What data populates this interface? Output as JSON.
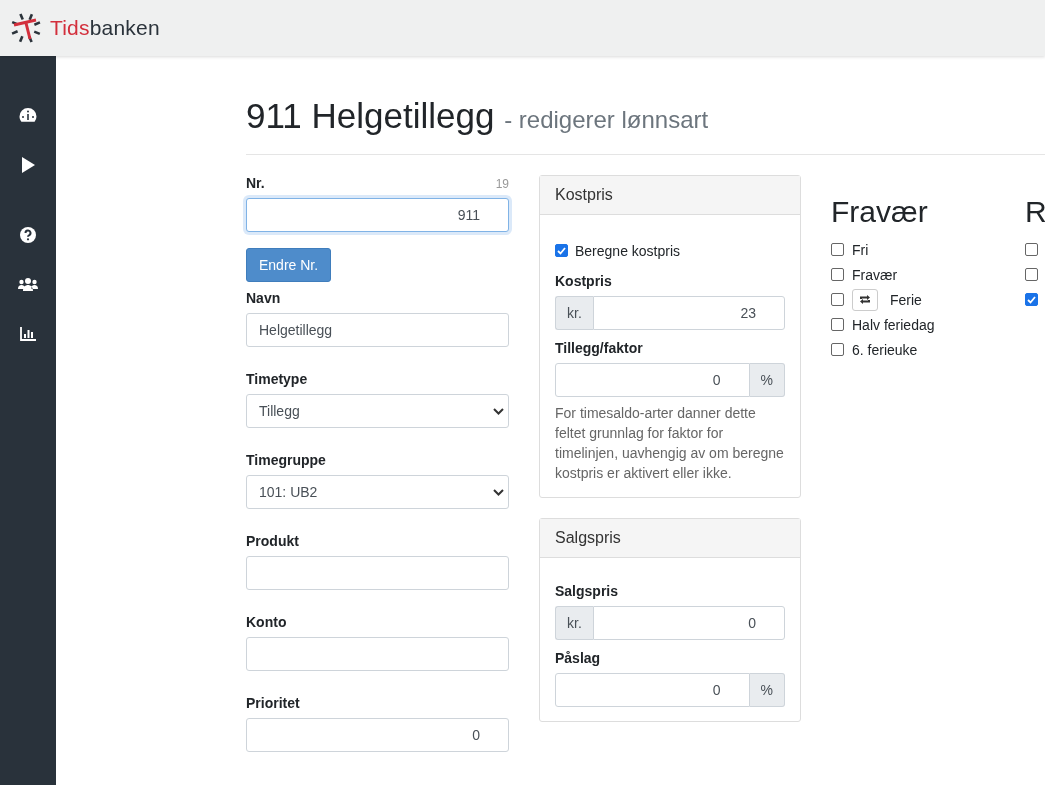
{
  "header": {
    "logo_red": "Tids",
    "logo_dark": "banken"
  },
  "sidebar": {
    "items": [
      {
        "kind": "dashboard"
      },
      {
        "kind": "play"
      },
      {
        "kind": "help"
      },
      {
        "kind": "users"
      },
      {
        "kind": "chart"
      }
    ]
  },
  "title": "911 Helgetillegg",
  "subtitle": "- redigerer lønnsart",
  "fields": [
    {
      "label": "Nr.",
      "kind": "number",
      "value": "911",
      "counter": "19",
      "focused": true,
      "button": "Endre Nr."
    },
    {
      "label": "Navn",
      "kind": "text",
      "value": "Helgetillegg",
      "focused": false
    },
    {
      "label": "Timetype",
      "kind": "select",
      "value": "Tillegg",
      "focused": false
    },
    {
      "label": "Timegruppe",
      "kind": "select",
      "value": "101: UB2",
      "focused": false
    },
    {
      "label": "Produkt",
      "kind": "text",
      "focused": false
    },
    {
      "label": "Konto",
      "kind": "text",
      "focused": false
    },
    {
      "label": "Prioritet",
      "kind": "number",
      "value": "0",
      "focused": false
    }
  ],
  "panels": [
    {
      "title": "Kostpris",
      "checkbox": {
        "label": "Beregne kostpris",
        "checked": true
      },
      "fields": [
        {
          "label": "Kostpris",
          "prefix": "kr.",
          "value": "23"
        },
        {
          "label": "Tillegg/faktor",
          "suffix": "%",
          "value": "0"
        }
      ],
      "help": "For timesaldo-arter danner dette feltet grunnlag for faktor for timelinjen, uavhengig av om beregne kostpris er aktivert eller ikke."
    },
    {
      "title": "Salgspris",
      "fields": [
        {
          "label": "Salgspris",
          "prefix": "kr.",
          "value": "0"
        },
        {
          "label": "Påslag",
          "suffix": "%",
          "value": "0"
        }
      ]
    }
  ],
  "groups": [
    {
      "title": "Fravær",
      "items": [
        {
          "label": "Fri",
          "checked": false,
          "kind": "plain"
        },
        {
          "label": "Fravær",
          "checked": false,
          "kind": "plain"
        },
        {
          "label": "Ferie",
          "checked": false,
          "kind": "swap"
        },
        {
          "label": "Halv feriedag",
          "checked": false,
          "kind": "plain"
        },
        {
          "label": "6. ferieuke",
          "checked": false,
          "kind": "plain"
        }
      ]
    },
    {
      "title": "R",
      "items": [
        {
          "checked": false,
          "kind": "plain"
        },
        {
          "checked": false,
          "kind": "plain"
        },
        {
          "checked": true,
          "kind": "plain"
        }
      ]
    }
  ]
}
